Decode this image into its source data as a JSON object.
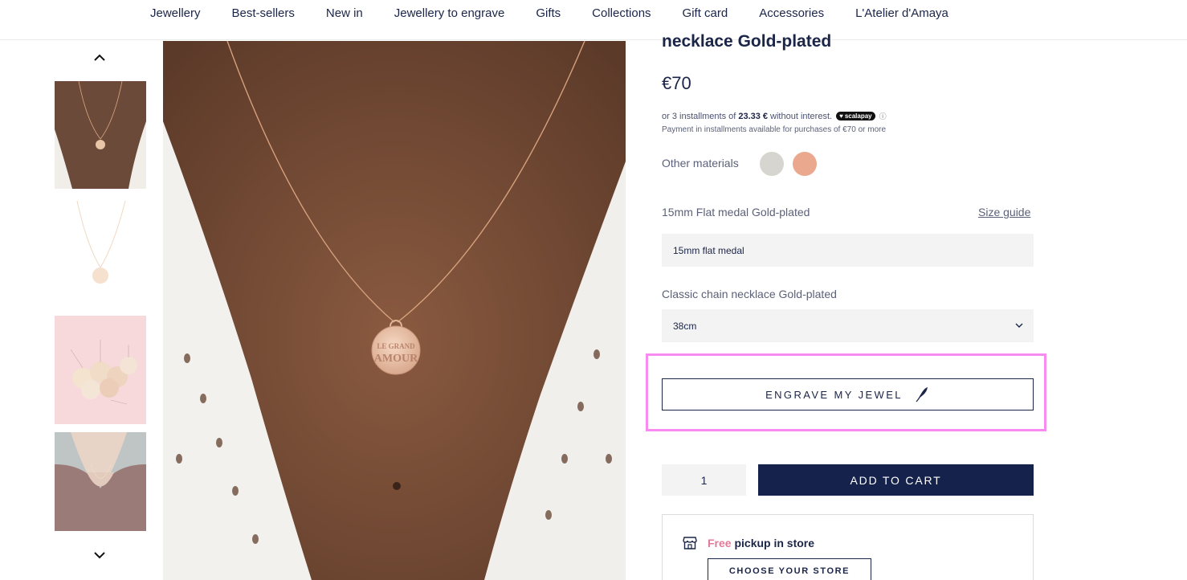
{
  "nav": {
    "items": [
      "Jewellery",
      "Best-sellers",
      "New in",
      "Jewellery to engrave",
      "Gifts",
      "Collections",
      "Gift card",
      "Accessories",
      "L'Atelier d'Amaya"
    ]
  },
  "gallery": {
    "main_pendant_text_line1": "LE GRAND",
    "main_pendant_text_line2": "AMOUR"
  },
  "product": {
    "title": "necklace Gold-plated",
    "price": "€70",
    "installments": {
      "prefix": "or 3 installments of",
      "amount": "23.33 €",
      "suffix": "without interest.",
      "provider": "scalapay",
      "note": "Payment in installments available for purchases of €70 or more"
    },
    "other_materials": {
      "label": "Other materials",
      "swatches": [
        "#d7d5d0",
        "#eaa88f"
      ]
    },
    "medal": {
      "label": "15mm Flat medal Gold-plated",
      "size_guide": "Size guide",
      "value": "15mm flat medal"
    },
    "chain": {
      "label": "Classic chain necklace Gold-plated",
      "value": "38cm"
    },
    "engrave_label": "ENGRAVE MY JEWEL",
    "quantity": "1",
    "add_to_cart": "ADD TO CART",
    "pickup": {
      "free": "Free",
      "rest": "pickup in store",
      "button": "CHOOSE YOUR STORE"
    }
  },
  "colors": {
    "navy": "#15224b",
    "highlight": "#f78bf0",
    "free_pink": "#e07a9a"
  }
}
